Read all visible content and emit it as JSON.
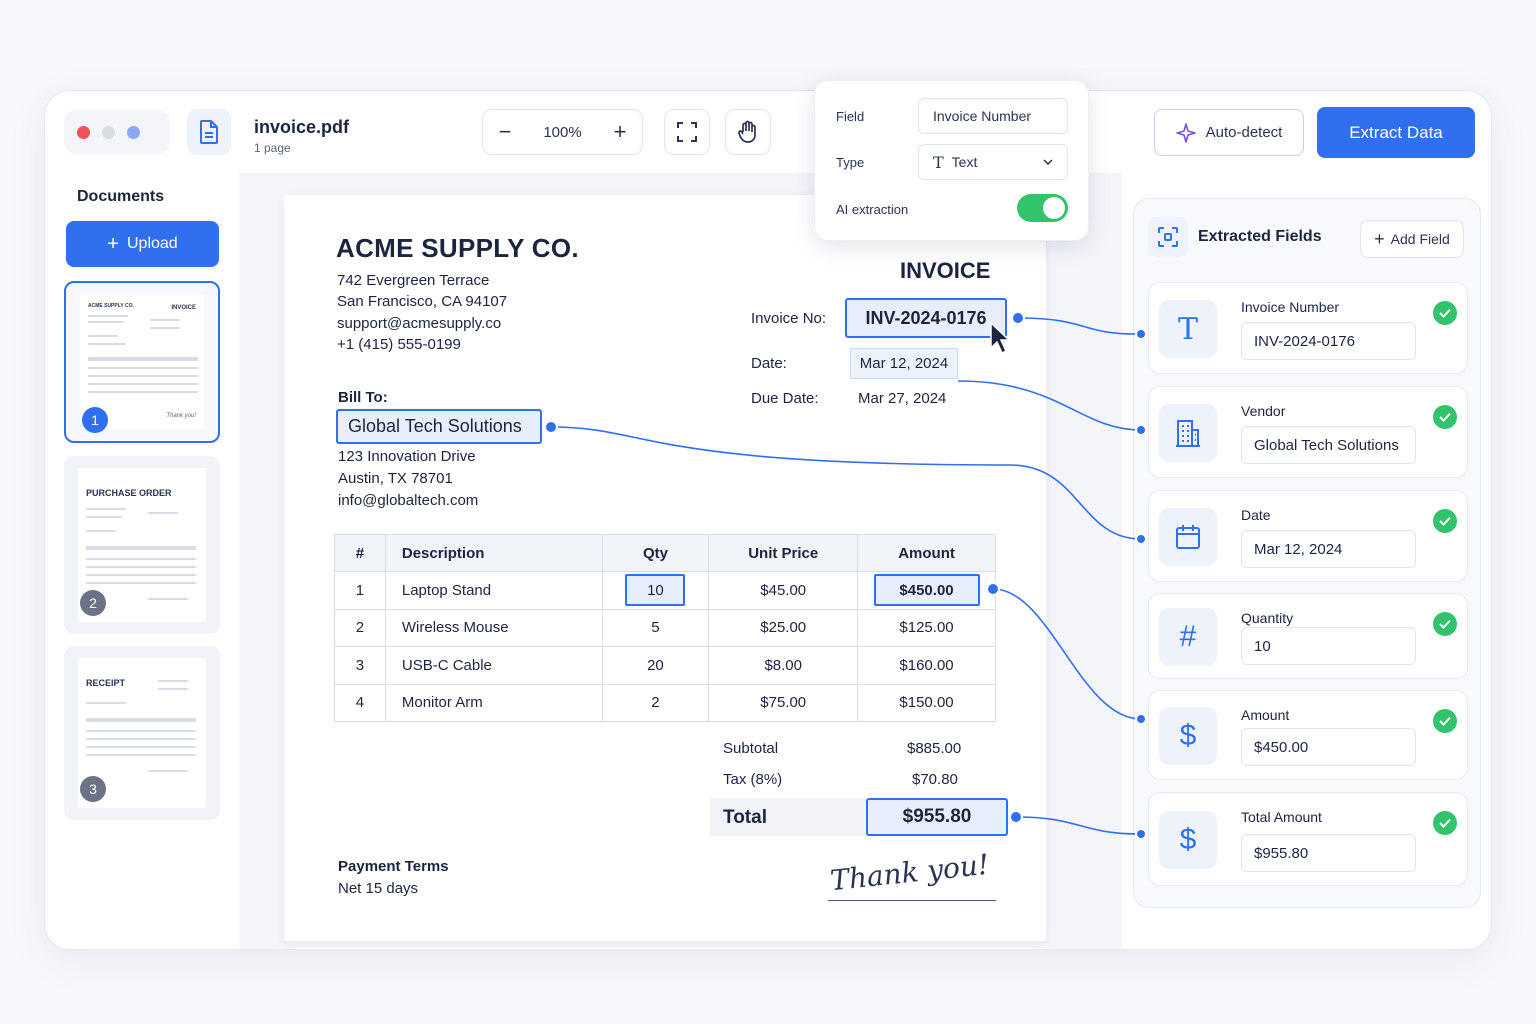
{
  "toolbar": {
    "file_name": "invoice.pdf",
    "file_pages": "1 page",
    "zoom_out_label": "−",
    "zoom_value": "100%",
    "zoom_in_label": "+",
    "autodetect_label": "Auto-detect",
    "extract_label": "Extract Data"
  },
  "popover": {
    "field_label": "Field",
    "field_value": "Invoice Number",
    "type_label": "Type",
    "type_value": "Text",
    "ai_label": "AI extraction",
    "ai_enabled": true
  },
  "sidebar": {
    "title": "Documents",
    "upload_label": "Upload",
    "thumbnails": [
      {
        "num": "1",
        "head": "ACME SUPPLY CO.",
        "head2": "INVOICE",
        "sign": "Thank you!"
      },
      {
        "num": "2",
        "head": "PURCHASE ORDER"
      },
      {
        "num": "3",
        "head": "RECEIPT"
      }
    ]
  },
  "invoice": {
    "company": "ACME SUPPLY CO.",
    "address": [
      "742 Evergreen Terrace",
      "San Francisco, CA 94107",
      "support@acmesupply.co",
      "+1 (415) 555-0199"
    ],
    "title": "INVOICE",
    "invoice_no_label": "Invoice No:",
    "invoice_no": "INV-2024-0176",
    "date_label": "Date:",
    "date": "Mar 12, 2024",
    "due_label": "Due Date:",
    "due_date": "Mar 27, 2024",
    "bill_to_label": "Bill To:",
    "bill_to_name": "Global Tech Solutions",
    "bill_to_address": [
      "123 Innovation Drive",
      "Austin, TX 78701",
      "info@globaltech.com"
    ],
    "table": {
      "headers": [
        "#",
        "Description",
        "Qty",
        "Unit Price",
        "Amount"
      ],
      "rows": [
        [
          "1",
          "Laptop Stand",
          "10",
          "$45.00",
          "$450.00"
        ],
        [
          "2",
          "Wireless Mouse",
          "5",
          "$25.00",
          "$125.00"
        ],
        [
          "3",
          "USB-C Cable",
          "20",
          "$8.00",
          "$160.00"
        ],
        [
          "4",
          "Monitor Arm",
          "2",
          "$75.00",
          "$150.00"
        ]
      ]
    },
    "subtotal_label": "Subtotal",
    "subtotal": "$885.00",
    "tax_label": "Tax (8%)",
    "tax": "$70.80",
    "total_label": "Total",
    "total": "$955.80",
    "payment_terms_label": "Payment Terms",
    "payment_terms": "Net 15 days",
    "signature": "Thank you!"
  },
  "extracted": {
    "title": "Extracted Fields",
    "add_field_label": "Add Field",
    "fields": [
      {
        "label": "Invoice Number",
        "value": "INV-2024-0176",
        "icon": "text-icon"
      },
      {
        "label": "Vendor",
        "value": "Global Tech Solutions",
        "icon": "building-icon"
      },
      {
        "label": "Date",
        "value": "Mar 12, 2024",
        "icon": "calendar-icon"
      },
      {
        "label": "Quantity",
        "value": "10",
        "icon": "hash-icon"
      },
      {
        "label": "Amount",
        "value": "$450.00",
        "icon": "dollar-icon"
      },
      {
        "label": "Total Amount",
        "value": "$955.80",
        "icon": "dollar-icon"
      }
    ]
  },
  "colors": {
    "accent": "#2f6ff0",
    "success": "#31c46b",
    "text": "#1c2440"
  }
}
